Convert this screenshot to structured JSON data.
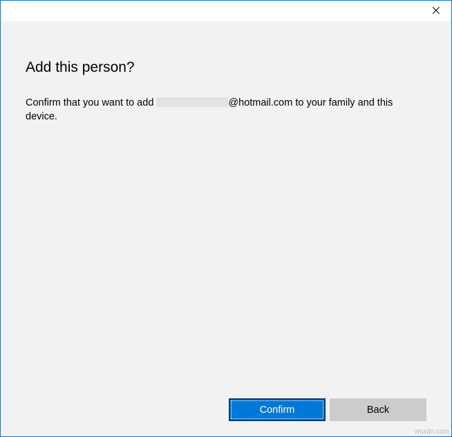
{
  "dialog": {
    "title": "Add this person?",
    "body_prefix": "Confirm that you want to add ",
    "body_suffix": "@hotmail.com to your family and this device."
  },
  "buttons": {
    "confirm": "Confirm",
    "back": "Back"
  },
  "watermark": "wsxdn.com"
}
